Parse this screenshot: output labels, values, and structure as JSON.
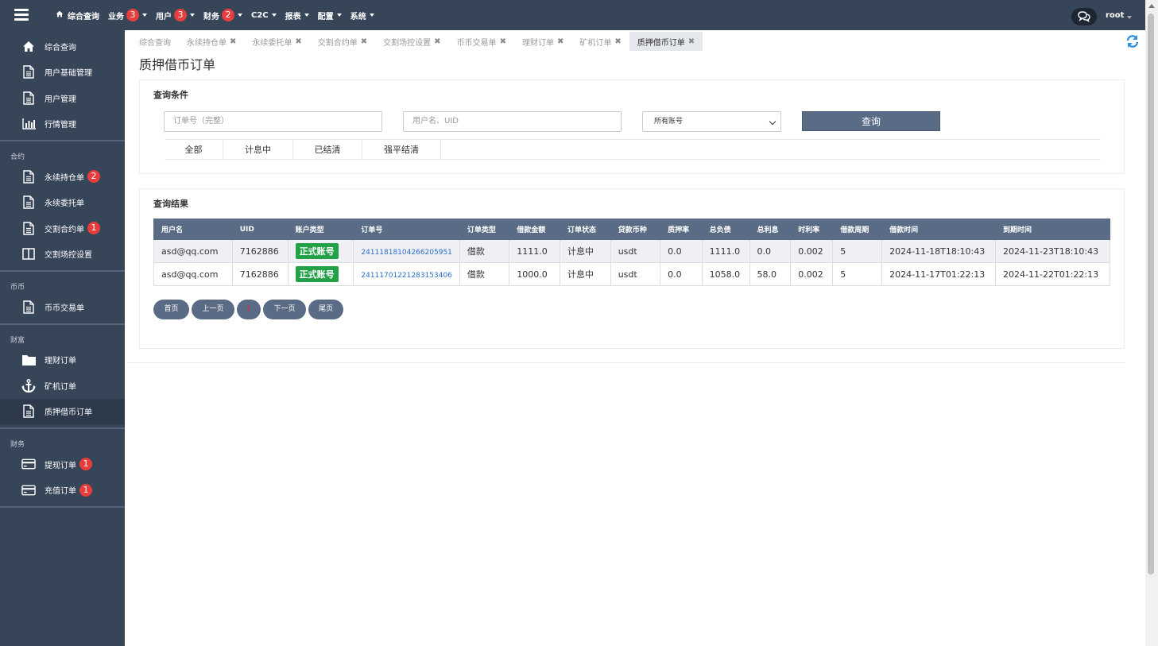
{
  "header": {
    "nav": [
      {
        "label": "综合查询",
        "badge": null,
        "caret": false,
        "icon": "home-icon"
      },
      {
        "label": "业务",
        "badge": "3",
        "caret": true
      },
      {
        "label": "用户",
        "badge": "3",
        "caret": true
      },
      {
        "label": "财务",
        "badge": "2",
        "caret": true
      },
      {
        "label": "C2C",
        "badge": null,
        "caret": true
      },
      {
        "label": "报表",
        "badge": null,
        "caret": true
      },
      {
        "label": "配置",
        "badge": null,
        "caret": true
      },
      {
        "label": "系统",
        "badge": null,
        "caret": true
      }
    ],
    "user": "root"
  },
  "sidebar": {
    "top_items": [
      {
        "label": "综合查询",
        "icon": "home-icon"
      },
      {
        "label": "用户基础管理",
        "icon": "document-icon"
      },
      {
        "label": "用户管理",
        "icon": "document-icon"
      },
      {
        "label": "行情管理",
        "icon": "bar-chart-icon"
      }
    ],
    "groups": [
      {
        "title": "合约",
        "items": [
          {
            "label": "永续持仓单",
            "icon": "document-icon",
            "badge": "2"
          },
          {
            "label": "永续委托单",
            "icon": "document-icon",
            "badge": null
          },
          {
            "label": "交割合约单",
            "icon": "document-icon",
            "badge": "1"
          },
          {
            "label": "交割场控设置",
            "icon": "columns-icon",
            "badge": null
          }
        ]
      },
      {
        "title": "币币",
        "items": [
          {
            "label": "币币交易单",
            "icon": "document-icon",
            "badge": null
          }
        ]
      },
      {
        "title": "财富",
        "items": [
          {
            "label": "理财订单",
            "icon": "folder-icon",
            "badge": null
          },
          {
            "label": "矿机订单",
            "icon": "anchor-icon",
            "badge": null
          },
          {
            "label": "质押借币订单",
            "icon": "document-icon",
            "badge": null,
            "active": true
          }
        ]
      },
      {
        "title": "财务",
        "items": [
          {
            "label": "提现订单",
            "icon": "credit-card-icon",
            "badge": "1"
          },
          {
            "label": "充值订单",
            "icon": "credit-card-icon",
            "badge": "1"
          }
        ]
      }
    ]
  },
  "tabs": [
    {
      "label": "综合查询",
      "closable": false
    },
    {
      "label": "永续持仓单",
      "closable": true
    },
    {
      "label": "永续委托单",
      "closable": true
    },
    {
      "label": "交割合约单",
      "closable": true
    },
    {
      "label": "交割场控设置",
      "closable": true
    },
    {
      "label": "币币交易单",
      "closable": true
    },
    {
      "label": "理财订单",
      "closable": true
    },
    {
      "label": "矿机订单",
      "closable": true
    },
    {
      "label": "质押借币订单",
      "closable": true,
      "active": true
    }
  ],
  "page": {
    "title": "质押借币订单"
  },
  "query": {
    "title": "查询条件",
    "order_placeholder": "订单号（完整）",
    "user_placeholder": "用户名、UID",
    "account_select": "所有账号",
    "search_label": "查询",
    "filters": [
      "全部",
      "计息中",
      "已结清",
      "强平结清"
    ]
  },
  "results": {
    "title": "查询结果",
    "columns": [
      "用户名",
      "UID",
      "账户类型",
      "订单号",
      "订单类型",
      "借款金额",
      "订单状态",
      "贷款币种",
      "质押率",
      "总负债",
      "总利息",
      "时利率",
      "借款周期",
      "借款时间",
      "到期时间"
    ],
    "rows": [
      [
        "asd@qq.com",
        "7162886",
        "正式账号",
        "24111818104266205951",
        "借款",
        "1111.0",
        "计息中",
        "usdt",
        "0.0",
        "1111.0",
        "0.0",
        "0.002",
        "5",
        "2024-11-18T18:10:43",
        "2024-11-23T18:10:43"
      ],
      [
        "asd@qq.com",
        "7162886",
        "正式账号",
        "24111701221283153406",
        "借款",
        "1000.0",
        "计息中",
        "usdt",
        "0.0",
        "1058.0",
        "58.0",
        "0.002",
        "5",
        "2024-11-17T01:22:13",
        "2024-11-22T01:22:13"
      ]
    ]
  },
  "pager": {
    "first": "首页",
    "prev": "上一页",
    "current": "1",
    "next": "下一页",
    "last": "尾页"
  },
  "colors": {
    "sidebar_bg": "#374559",
    "header_bg": "#374559",
    "table_header_bg": "#5a6b85",
    "badge_red": "#e73d3d",
    "account_green": "#22a147",
    "link_blue": "#2a6fc9"
  }
}
